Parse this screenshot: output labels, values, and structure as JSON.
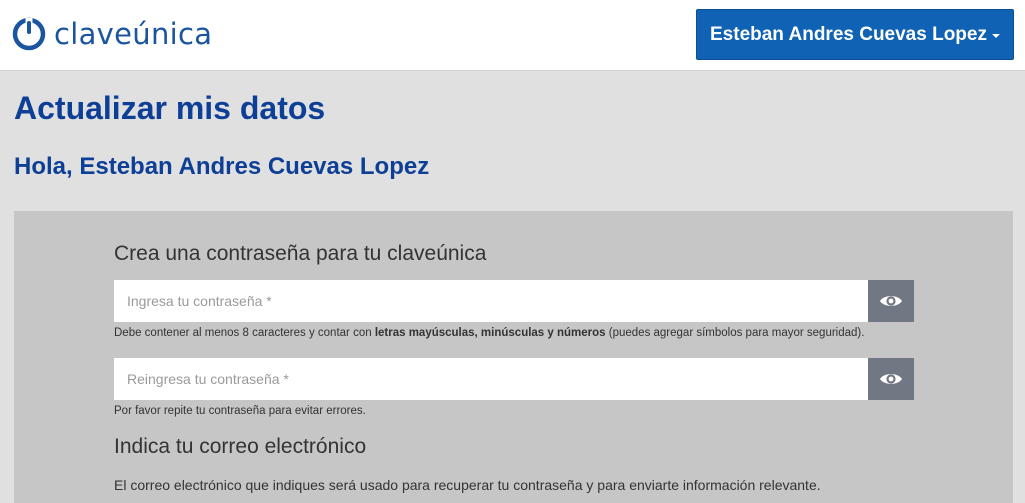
{
  "header": {
    "logo_text": "claveúnica",
    "user_menu_label": "Esteban Andres Cuevas Lopez"
  },
  "page": {
    "title": "Actualizar mis datos",
    "greeting": "Hola, Esteban Andres Cuevas Lopez"
  },
  "password_section": {
    "title": "Crea una contraseña para tu claveúnica",
    "password_placeholder": "Ingresa tu contraseña *",
    "password_help_prefix": "Debe contener al menos 8 caracteres y contar con ",
    "password_help_bold": "letras mayúsculas, minúsculas y números",
    "password_help_suffix": " (puedes agregar símbolos para mayor seguridad).",
    "confirm_placeholder": "Reingresa tu contraseña *",
    "confirm_help": "Por favor repite tu contraseña para evitar errores."
  },
  "email_section": {
    "title": "Indica tu correo electrónico",
    "description": "El correo electrónico que indiques será usado para recuperar tu contraseña y para enviarte información relevante."
  },
  "colors": {
    "brand_blue": "#0f62b4",
    "heading_blue": "#0d3f96",
    "eye_button": "#6f7883"
  },
  "icons": {
    "logo": "power-icon",
    "menu_caret": "caret-down-icon",
    "toggle_visibility": "eye-icon"
  }
}
